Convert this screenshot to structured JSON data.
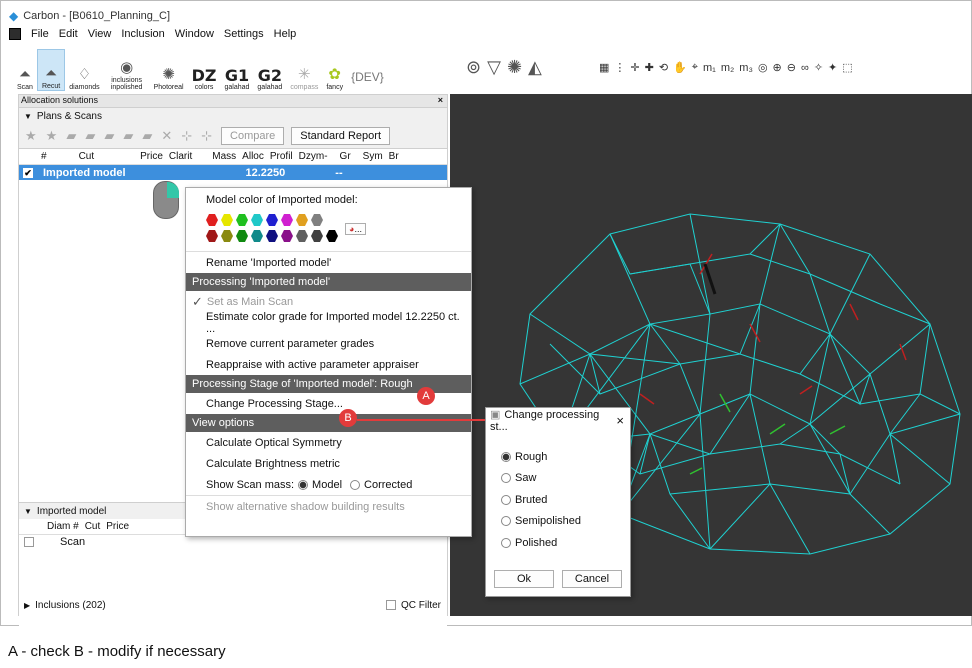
{
  "window": {
    "title": "Carbon - [B0610_Planning_C]"
  },
  "menu": [
    "File",
    "Edit",
    "View",
    "Inclusion",
    "Window",
    "Settings",
    "Help"
  ],
  "toolbar": {
    "items": [
      {
        "label": "Scan",
        "icon": "diamond-outline-icon"
      },
      {
        "label": "Recut",
        "icon": "recut-icon"
      },
      {
        "label": "diamonds",
        "icon": "diamonds-icon"
      },
      {
        "label": "inclusions inpolished",
        "icon": "inclusions-icon"
      },
      {
        "label": "Photoreal",
        "icon": "photoreal-icon"
      },
      {
        "label": "colors",
        "big": "DZ"
      },
      {
        "label": "galahad",
        "big": "G1"
      },
      {
        "label": "galahad",
        "big": "G2"
      },
      {
        "label": "compass",
        "icon": "compass-icon"
      },
      {
        "label": "fancy",
        "icon": "fancy-icon"
      },
      {
        "label": "",
        "big": "{DEV}"
      }
    ]
  },
  "left_panel": {
    "title": "Allocation solutions",
    "plans_header": "Plans & Scans",
    "compare_label": "Compare",
    "report_label": "Standard Report",
    "columns": [
      "#",
      "Cut",
      "Price",
      "Clarit",
      "Mass",
      "Alloc",
      "Profil",
      "Dzym-",
      "Gr",
      "Sym",
      "Br"
    ],
    "selected_row": {
      "name": "Imported model",
      "mass": "12.2250",
      "gr": "--"
    },
    "imported_header": "Imported model",
    "imported_columns": [
      "Diam #",
      "Cut",
      "Price"
    ],
    "imported_row": "Scan",
    "inclusions_label": "Inclusions (202)",
    "qc_label": "QC Filter"
  },
  "context_menu": {
    "model_color_label": "Model color of Imported model:",
    "more_colors": "...",
    "rename": "Rename 'Imported model'",
    "processing_header": "Processing 'Imported model'",
    "set_main": "Set as Main Scan",
    "estimate": "Estimate color grade for Imported model 12.2250 ct. ...",
    "remove": "Remove current parameter grades",
    "reappraise": "Reappraise with active parameter appraiser",
    "stage_header": "Processing Stage of 'Imported model': Rough",
    "change_stage": "Change Processing Stage...",
    "view_header": "View options",
    "optical": "Calculate Optical Symmetry",
    "brightness": "Calculate Brightness metric",
    "show_mass": "Show Scan mass:",
    "model_opt": "Model",
    "corrected_opt": "Corrected",
    "shadow": "Show alternative shadow building results"
  },
  "dialog": {
    "title": "Change processing st...",
    "options": [
      "Rough",
      "Saw",
      "Bruted",
      "Semipolished",
      "Polished"
    ],
    "selected": "Rough",
    "ok": "Ok",
    "cancel": "Cancel"
  },
  "annotations": {
    "a": "A",
    "b": "B"
  },
  "caption": "A - check B - modify if necessary",
  "colors": {
    "row1": [
      "#e02020",
      "#e6e600",
      "#20c020",
      "#20c8c8",
      "#2020d0",
      "#d020d0",
      "#e0a020",
      "#808080",
      "#ffffff"
    ],
    "row2": [
      "#a01818",
      "#8a8a10",
      "#108a10",
      "#108a8a",
      "#101080",
      "#8a108a",
      "#606060",
      "#404040",
      "#000000"
    ],
    "wireframe": "#1fd1d1",
    "badge": "#e23b3b"
  }
}
